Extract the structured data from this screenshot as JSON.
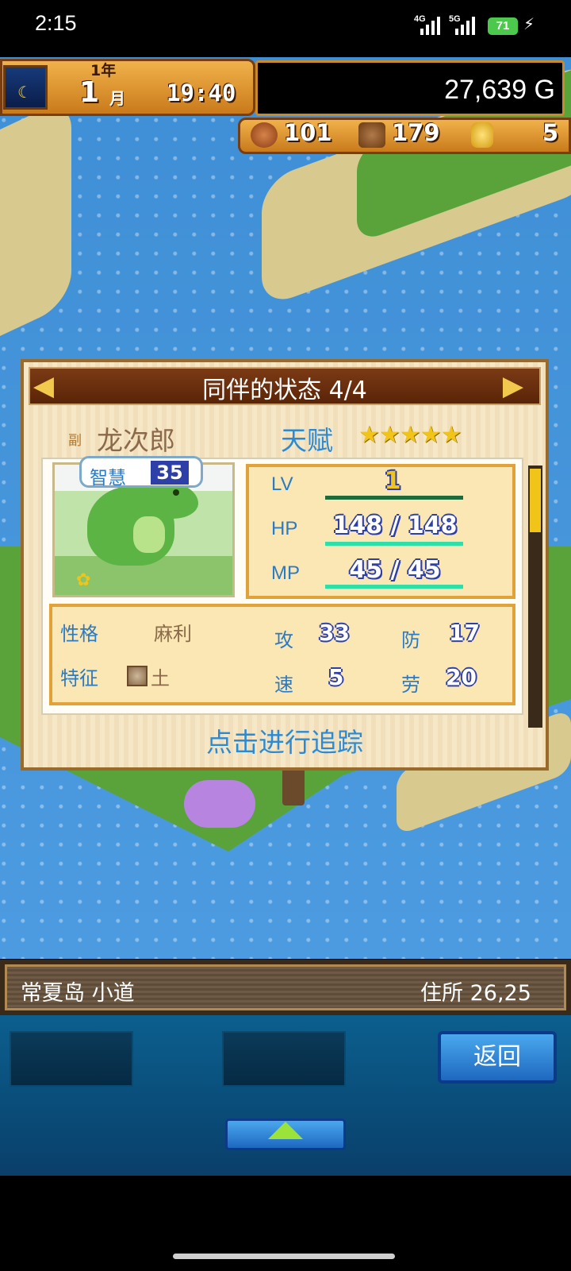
{
  "status_bar": {
    "time": "2:15",
    "network_1": "4G",
    "network_2": "5G",
    "battery": "71"
  },
  "hud": {
    "year": "1年",
    "month": "1",
    "month_unit": "月",
    "time": "19:40",
    "gold": "27,639 G",
    "resources": {
      "food": "101",
      "wood": "179",
      "coin": "5"
    }
  },
  "dialog": {
    "title": "同伴的状态 4/4",
    "role_tag": "副",
    "name": "龙次郎",
    "talent_label": "天赋",
    "talent_stars": "★★★★★",
    "wisdom_label": "智慧",
    "wisdom_value": "35",
    "stats": {
      "lv_label": "LV",
      "lv_value": "1",
      "hp_label": "HP",
      "hp_value": "148 / 148",
      "mp_label": "MP",
      "mp_value": "45 / 45"
    },
    "attributes": {
      "personality_label": "性格",
      "personality_value": "麻利",
      "trait_label": "特征",
      "trait_value": "土",
      "attack_label": "攻",
      "attack_value": "33",
      "defense_label": "防",
      "defense_value": "17",
      "speed_label": "速",
      "speed_value": "5",
      "labor_label": "劳",
      "labor_value": "20"
    },
    "track_button": "点击进行追踪"
  },
  "location": {
    "name": "常夏岛  小道",
    "address": "住所  26,25"
  },
  "bottom": {
    "back_button": "返回"
  },
  "colors": {
    "accent_blue": "#2a8ad6",
    "hud_orange": "#f1b24a",
    "stat_badge": "#2e3fa8"
  },
  "icons": [
    "moon-icon",
    "meat-icon",
    "wood-icon",
    "coin-icon",
    "left-arrow-icon",
    "right-arrow-icon",
    "star-icon",
    "earth-icon",
    "up-arrow-icon"
  ]
}
